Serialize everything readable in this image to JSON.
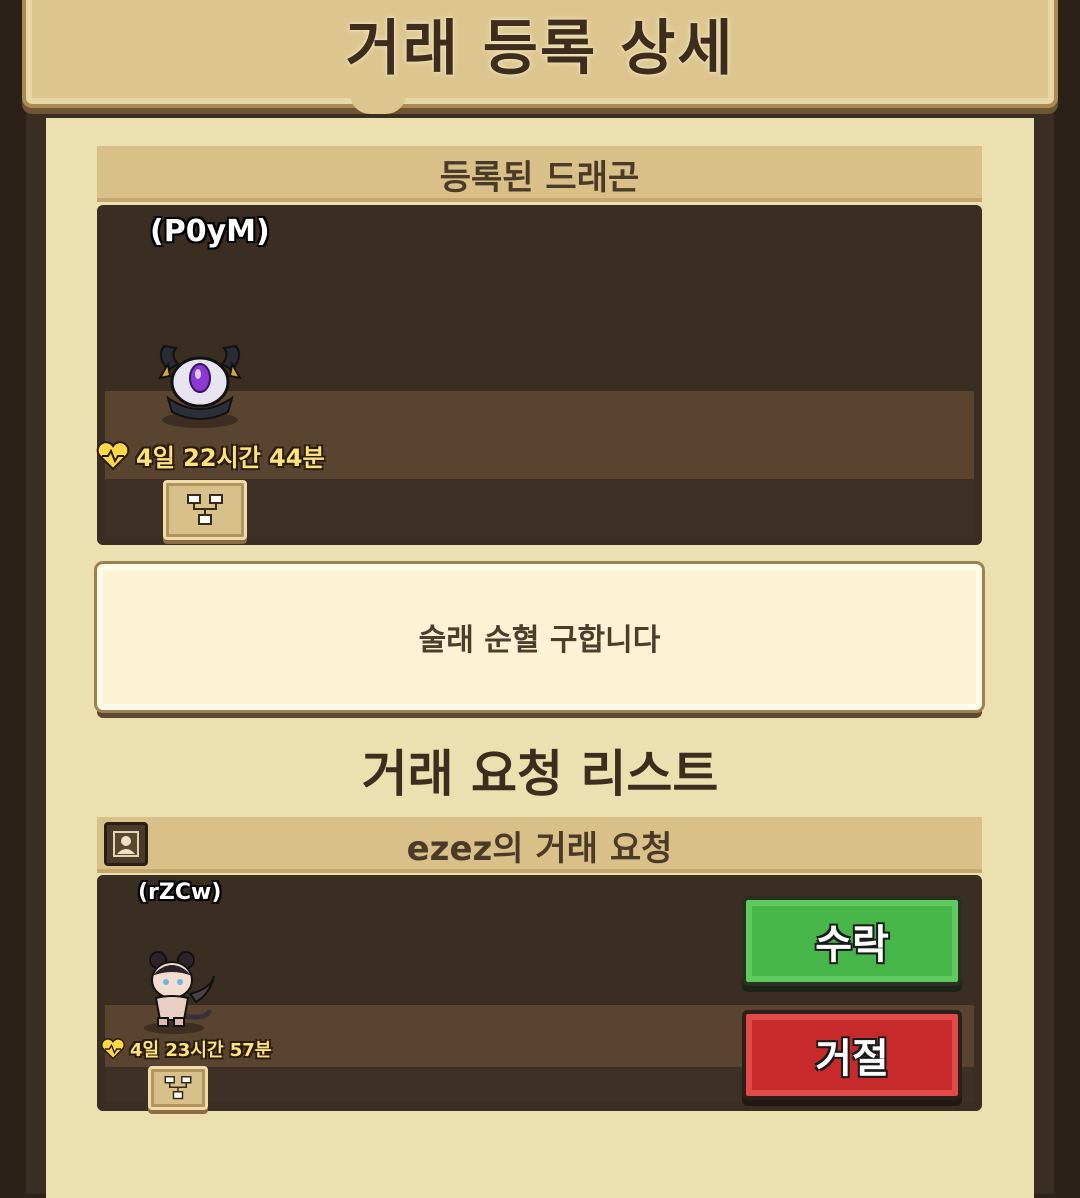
{
  "header": {
    "title": "거래 등록 상세"
  },
  "registered": {
    "section_label": "등록된 드래곤",
    "dragon_name": "(P0yM)",
    "timer": "4일 22시간 44분",
    "tree_icon": "family-tree-icon"
  },
  "message": {
    "text": "술래 순혈 구합니다"
  },
  "request_list": {
    "title": "거래 요청 리스트",
    "requests": [
      {
        "header": "ezez의 거래 요청",
        "profile_icon": "profile-icon",
        "dragon_name": "(rZCw)",
        "timer": "4일 23시간 57분",
        "accept_label": "수락",
        "reject_label": "거절"
      }
    ]
  },
  "colors": {
    "accent_green": "#46b54a",
    "accent_red": "#c62a2a",
    "timer_yellow": "#ffe27a",
    "panel_bg": "#ede0b0"
  }
}
